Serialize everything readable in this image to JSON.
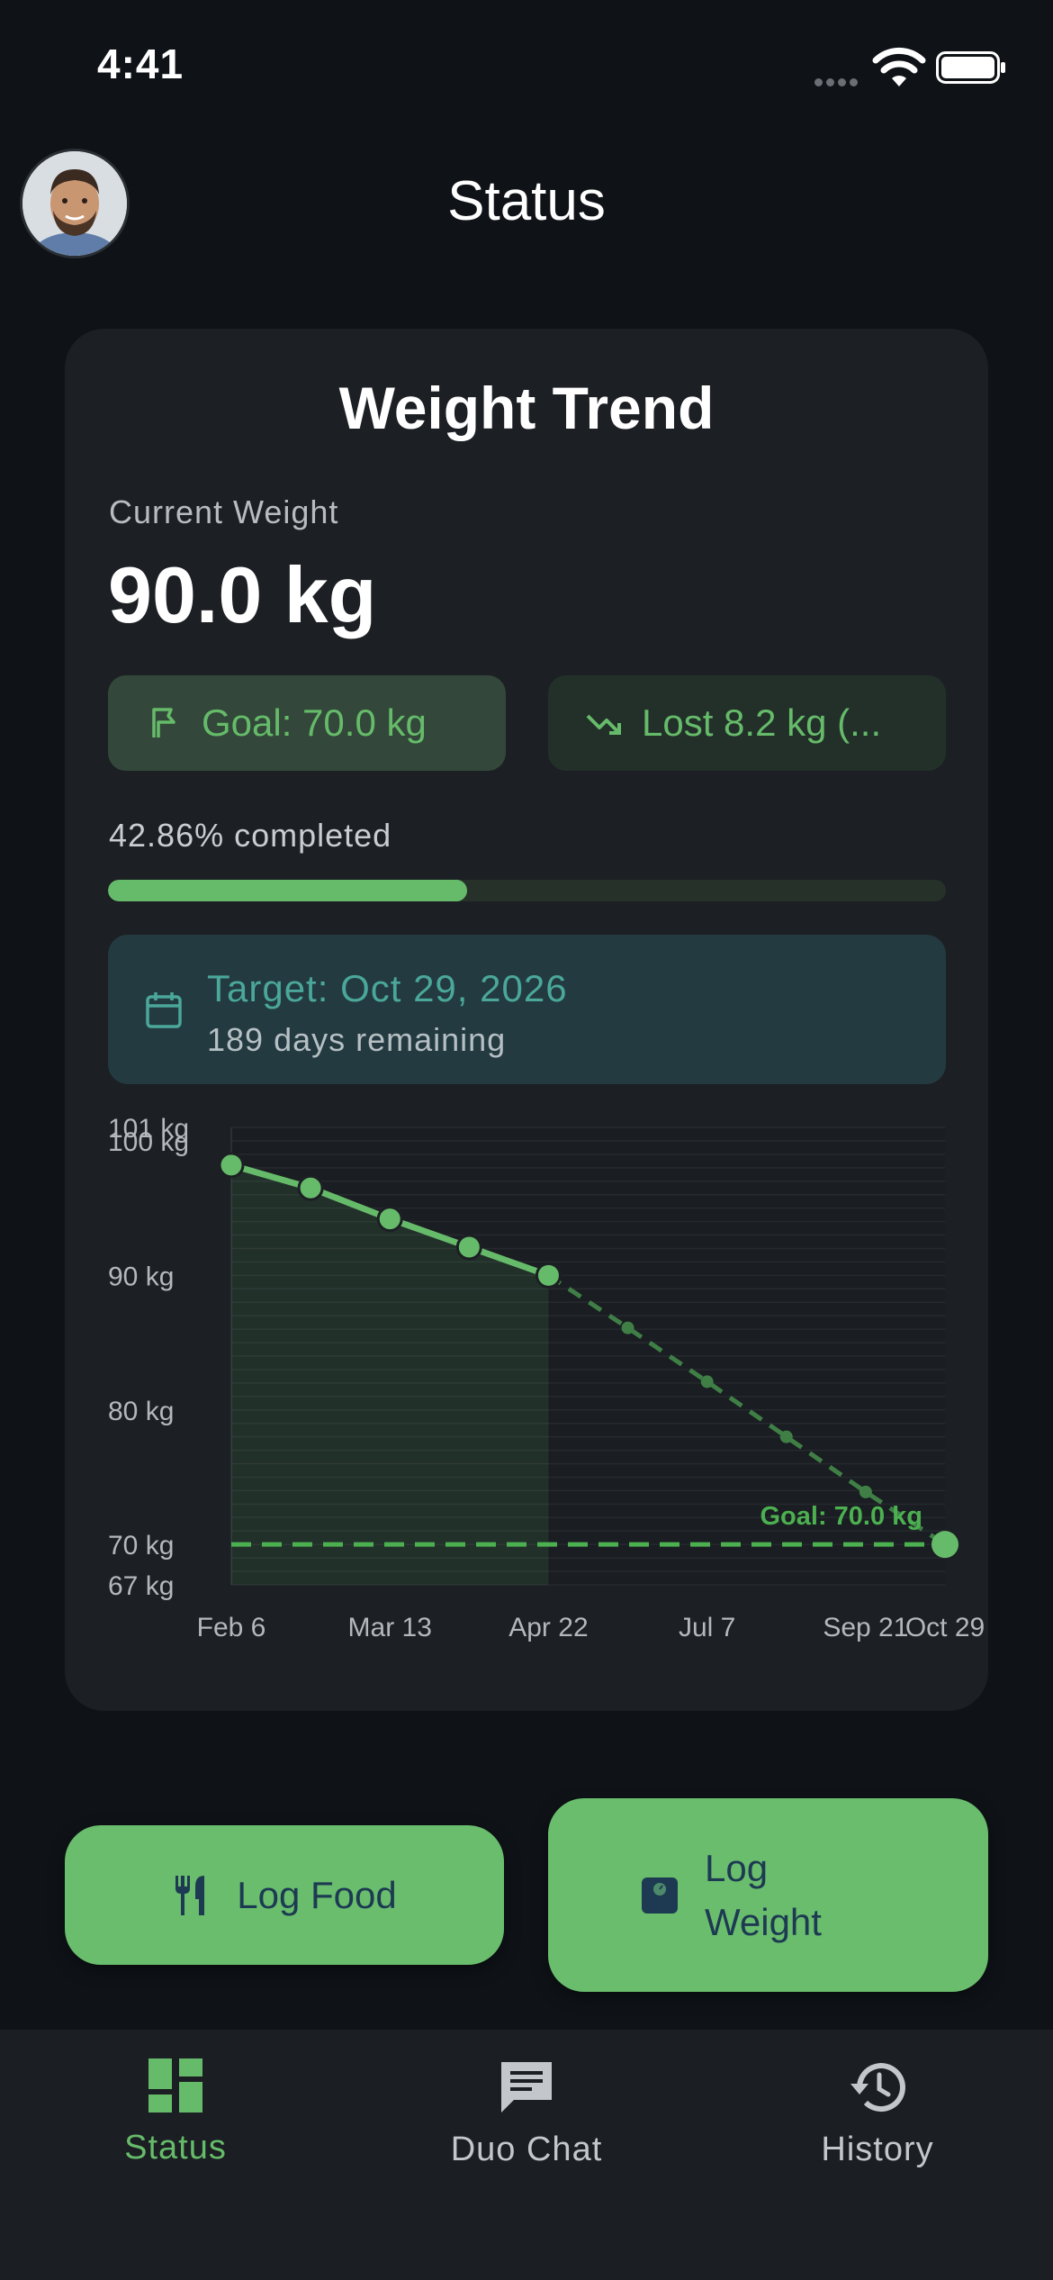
{
  "status_bar": {
    "time": "4:41"
  },
  "header": {
    "title": "Status",
    "avatar_icon": "user-avatar"
  },
  "weight_card": {
    "title": "Weight Trend",
    "current_label": "Current Weight",
    "current_value": "90.0 kg",
    "goal_chip": {
      "icon": "flag-icon",
      "label": "Goal: 70.0 kg"
    },
    "lost_chip": {
      "icon": "trending-down-icon",
      "label": "Lost 8.2 kg (..."
    },
    "progress_text": "42.86% completed",
    "progress_fraction": 0.4286,
    "target": {
      "icon": "calendar-icon",
      "title": "Target: Oct 29, 2026",
      "subtitle": "189 days remaining"
    }
  },
  "chart_data": {
    "type": "line",
    "y_tick_labels": [
      "101 kg",
      "100 kg",
      "90 kg",
      "80 kg",
      "70 kg",
      "67 kg"
    ],
    "y_ticks": [
      101,
      100,
      90,
      80,
      70,
      67
    ],
    "ylim": [
      67,
      101
    ],
    "x_tick_labels": [
      "Feb 6",
      "Mar 13",
      "Apr 22",
      "Jul 7",
      "Sep 21",
      "Oct 29"
    ],
    "goal_label": "Goal: 70.0 kg",
    "goal_value": 70.0,
    "series": [
      {
        "kind": "actual",
        "style": "solid",
        "x_index": [
          0,
          1,
          2,
          3,
          4
        ],
        "values": [
          98.2,
          96.5,
          94.2,
          92.1,
          90.0
        ]
      },
      {
        "kind": "projected",
        "style": "dashed",
        "x_index": [
          4,
          5,
          6,
          7,
          8,
          9
        ],
        "values": [
          90.0,
          86.1,
          82.1,
          78.0,
          73.9,
          70.0
        ]
      }
    ],
    "colors": {
      "line": "#66bb6a",
      "projection": "#3f7f46",
      "goal": "#4caf50"
    },
    "grid": true
  },
  "actions": {
    "log_food": {
      "icon": "fork-knife-icon",
      "label": "Log Food"
    },
    "log_weight": {
      "icon": "scale-icon",
      "label": "Log Weight"
    }
  },
  "bottom_nav": {
    "items": [
      {
        "icon": "dashboard-icon",
        "label": "Status",
        "active": true
      },
      {
        "icon": "chat-icon",
        "label": "Duo Chat",
        "active": false
      },
      {
        "icon": "history-icon",
        "label": "History",
        "active": false
      }
    ]
  },
  "theme": {
    "accent": "#66bb6a",
    "background": "#0f1318",
    "card": "#1c1f23"
  }
}
